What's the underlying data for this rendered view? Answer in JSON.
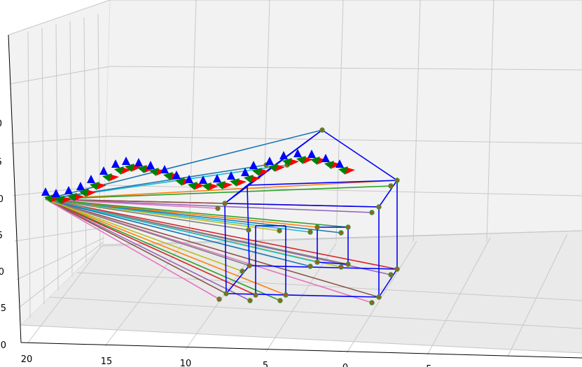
{
  "chart_data": {
    "type": "3d-line",
    "title": "",
    "grid": true,
    "x_ticks": [
      "20",
      "15",
      "10",
      "5",
      "0",
      "-5"
    ],
    "z_ticks": [
      "0",
      "5",
      "0",
      "5",
      "0",
      "5",
      "0",
      "5",
      "0"
    ],
    "scene": {
      "house_wireframe_color": "#0000ff",
      "camera_path_origin": "left",
      "ray_colors": [
        "#1f77b4",
        "#ff7f0e",
        "#2ca02c",
        "#d62728",
        "#9467bd",
        "#8c564b",
        "#e377c2",
        "#7f7f7f",
        "#bcbd22",
        "#17becf"
      ],
      "axis_arrow_colors": {
        "x": "#ff0000",
        "y": "#008000",
        "z": "#0000ff"
      }
    }
  }
}
